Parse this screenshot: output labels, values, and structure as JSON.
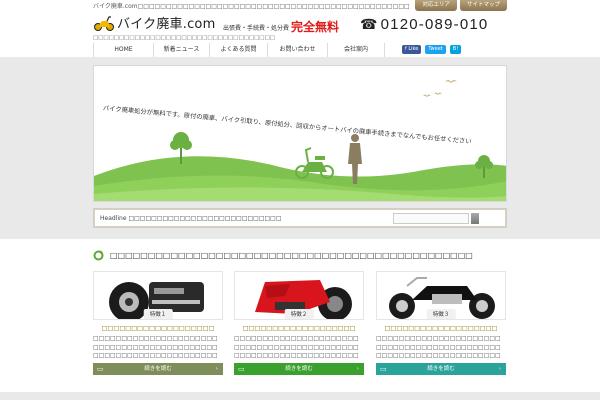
{
  "header": {
    "tagline": "バイク廃車.com□□□□□□□□□□□□□□□□□□□□□□□□□□□□□□□□□□□□□□□□□□□□□□□□",
    "top_buttons": [
      "対応エリア",
      "サイトマップ"
    ],
    "logo_text": "バイク廃車.com",
    "sub_text": "□□□□□□□□□□□□□□□□□□□□□□□□□□□□□□□□□□□",
    "fee_text": "出張費・手続費・処分費",
    "free_text": "完全無料",
    "phone_icon": "phone-icon",
    "phone": "0120-089-010"
  },
  "nav": {
    "items": [
      "HOME",
      "新着ニュース",
      "よくある質問",
      "お問い合わせ",
      "会社案内"
    ]
  },
  "social": {
    "like": "Like",
    "tweet": "Tweet",
    "share": "B!"
  },
  "hero": {
    "text": "バイク廃車処分が無料です。原付の廃車、バイク引取り、原付処分、回収からオートバイの廃車手続きまでなんでもお任せください"
  },
  "headline": {
    "label": "Headline",
    "text": "□□□□□□□□□□□□□□□□□□□□□□□□□□□"
  },
  "section": {
    "title": "□□□□□□□□□□□□□□□□□□□□□□□□□□□□□□□□□□□□□□□□□□□□□□□□"
  },
  "cards": [
    {
      "badge": "特徴１",
      "title": "□□□□□□□□□□□□□□□□□□□",
      "body": "□□□□□□□□□□□□□□□□□□□□□□□□□□□□□□□□□□□□□□□□□□□□□□□□□□□□□□□□□□□□□□□□□□□□",
      "button": "続きを読む",
      "color": "#7d8e5a"
    },
    {
      "badge": "特徴２",
      "title": "□□□□□□□□□□□□□□□□□□□",
      "body": "□□□□□□□□□□□□□□□□□□□□□□□□□□□□□□□□□□□□□□□□□□□□□□□□□□□□□□□□□□□□□□□□□□□□",
      "button": "続きを読む",
      "color": "#3aa02e"
    },
    {
      "badge": "特徴３",
      "title": "□□□□□□□□□□□□□□□□□□□",
      "body": "□□□□□□□□□□□□□□□□□□□□□□□□□□□□□□□□□□□□□□□□□□□□□□□□□□□□□□□□□□□□□□□□□□□□",
      "button": "続きを読む",
      "color": "#2aa39a"
    }
  ]
}
